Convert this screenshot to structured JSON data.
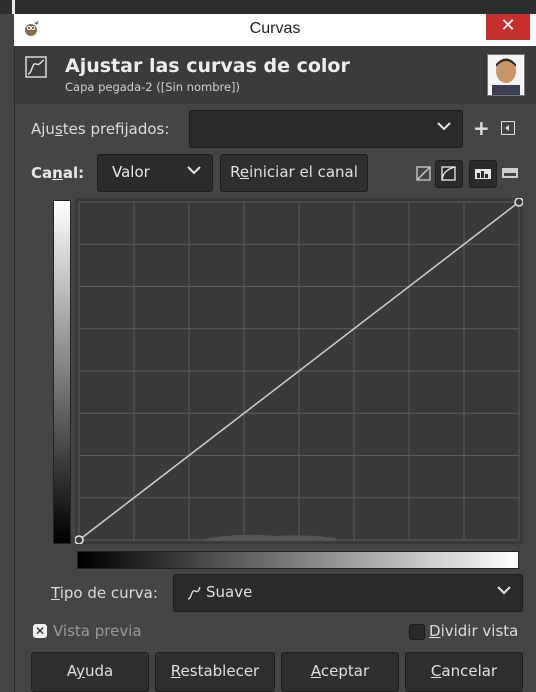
{
  "window": {
    "title": "Curvas",
    "close_glyph": "✕"
  },
  "header": {
    "title": "Ajustar las curvas de color",
    "subtitle": "Capa pegada-2 ([Sin nombre])",
    "icon": "curve-icon"
  },
  "presets": {
    "label": "Ajustes prefijados:",
    "value": "",
    "add_label": "+"
  },
  "channel": {
    "label": "Canal:",
    "value": "Valor",
    "reset_label": "Reiniciar el canal"
  },
  "graph": {
    "curve_points": [
      [
        0,
        0
      ],
      [
        255,
        255
      ]
    ]
  },
  "curve_type": {
    "label": "Tipo de curva:",
    "value": "Suave"
  },
  "preview": {
    "label": "Vista previa",
    "checked": true
  },
  "split_view": {
    "label": "Dividir vista",
    "checked": false
  },
  "buttons": {
    "help": "Ayuda",
    "reset": "Restablecer",
    "ok": "Aceptar",
    "cancel": "Cancelar"
  }
}
